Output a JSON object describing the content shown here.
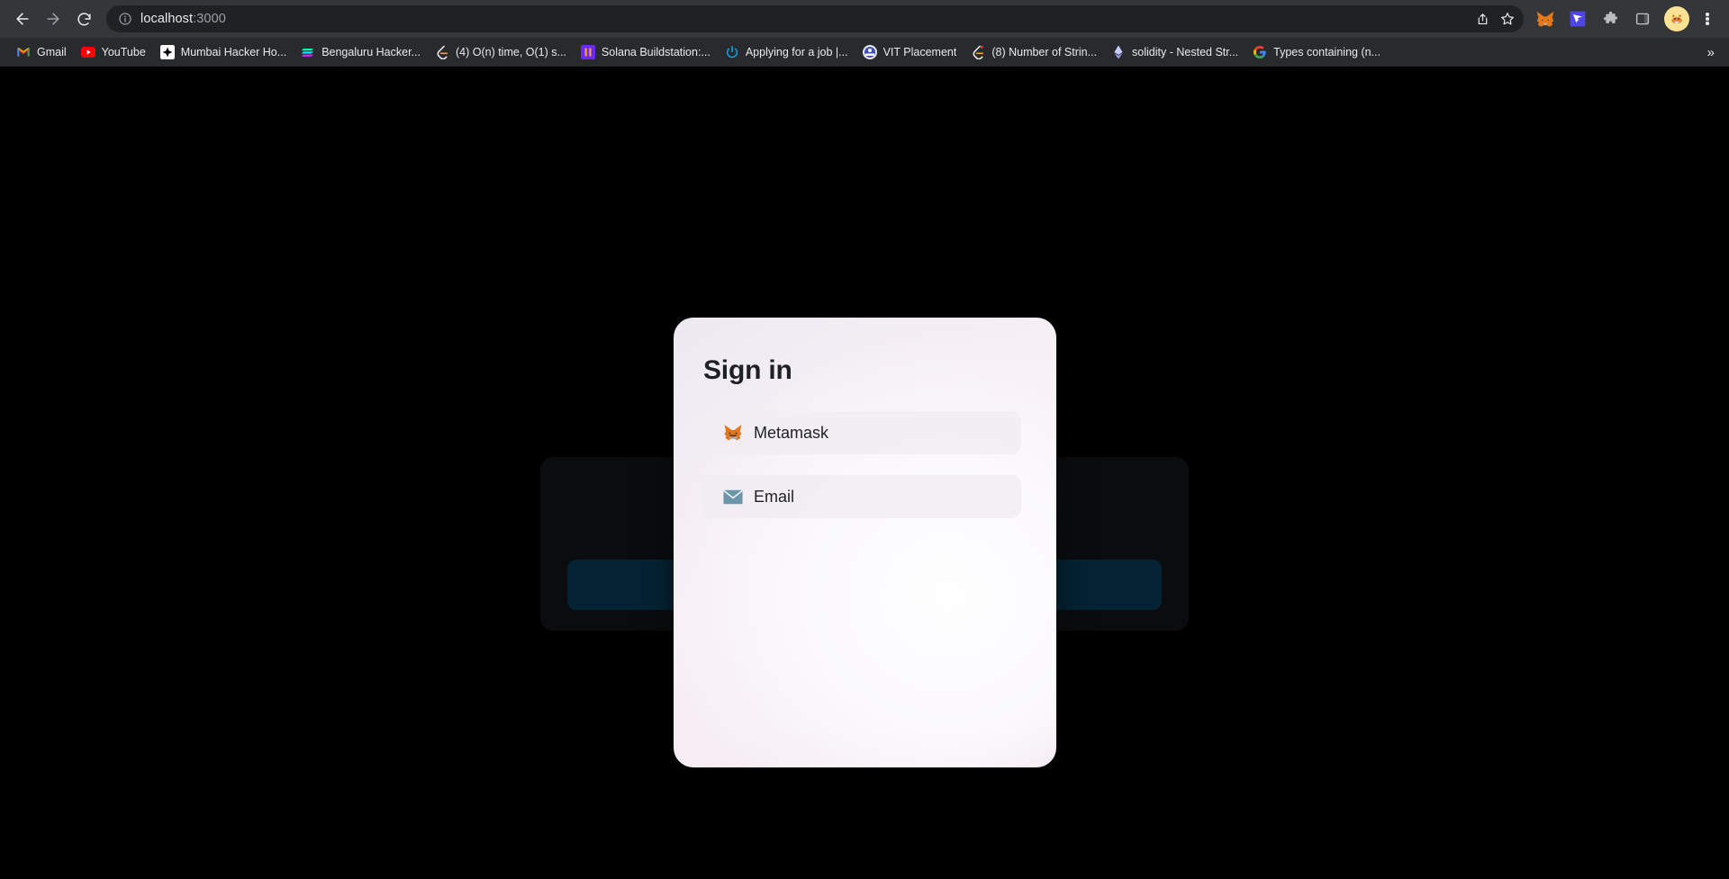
{
  "browser": {
    "nav": {
      "back_label": "Back",
      "forward_label": "Forward",
      "reload_label": "Reload"
    },
    "omnibox": {
      "site_info_label": "View site information",
      "url_host": "localhost",
      "url_port": ":3000",
      "share_label": "Share this page",
      "bookmark_label": "Bookmark this tab"
    },
    "extensions": [
      {
        "name": "metamask-extension-icon",
        "label": "MetaMask"
      },
      {
        "name": "blue-extension-icon",
        "label": "Extension"
      },
      {
        "name": "puzzle-icon",
        "label": "Extensions"
      },
      {
        "name": "side-panel-icon",
        "label": "Side panel"
      }
    ],
    "profile_label": "Profile",
    "menu_label": "Customize and control Google Chrome",
    "bookmarks": [
      {
        "label": "Gmail",
        "icon": "gmail-icon"
      },
      {
        "label": "YouTube",
        "icon": "youtube-icon"
      },
      {
        "label": "Mumbai Hacker Ho...",
        "icon": "mumbai-hacker-house-icon"
      },
      {
        "label": "Bengaluru Hacker...",
        "icon": "solana-icon"
      },
      {
        "label": "(4) O(n) time, O(1) s...",
        "icon": "leetcode-icon"
      },
      {
        "label": "Solana Buildstation:...",
        "icon": "solana-buildstation-icon"
      },
      {
        "label": "Applying for a job |...",
        "icon": "power-icon"
      },
      {
        "label": "VIT Placement",
        "icon": "vit-icon"
      },
      {
        "label": "(8) Number of Strin...",
        "icon": "leetcode-icon"
      },
      {
        "label": "solidity - Nested Str...",
        "icon": "ethereum-icon"
      },
      {
        "label": "Types containing (n...",
        "icon": "google-icon"
      }
    ],
    "bookmarks_overflow": "»"
  },
  "page": {
    "background_color": "#000000",
    "card_color": "#0a0c0e",
    "button_color": "#042334"
  },
  "modal": {
    "title": "Sign in",
    "options": [
      {
        "label": "Metamask",
        "icon": "metamask-fox-icon"
      },
      {
        "label": "Email",
        "icon": "envelope-icon"
      }
    ]
  }
}
